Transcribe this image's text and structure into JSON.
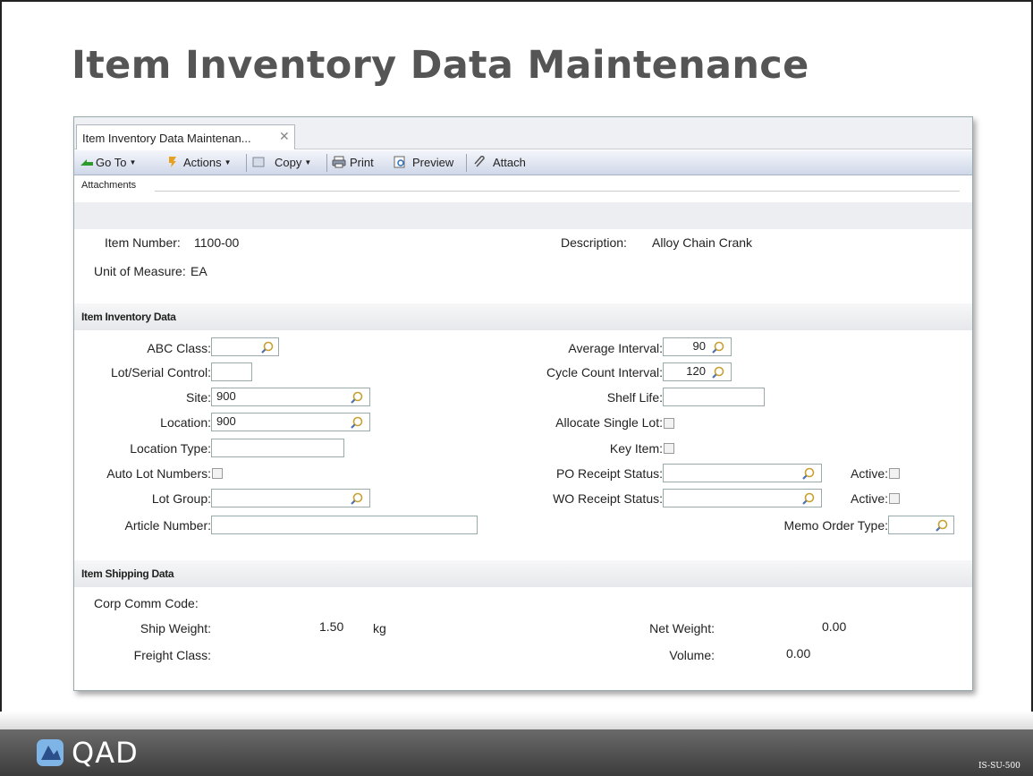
{
  "slide": {
    "title": "Item Inventory Data Maintenance",
    "code": "IS-SU-500"
  },
  "footer": {
    "logo_text": "QAD"
  },
  "window": {
    "tab_label": "Item Inventory Data Maintenan...",
    "toolbar": {
      "goto": "Go To",
      "actions": "Actions",
      "copy": "Copy",
      "print": "Print",
      "preview": "Preview",
      "attach": "Attach"
    },
    "attachments_label": "Attachments"
  },
  "header": {
    "item_number_label": "Item Number:",
    "item_number": "1100-00",
    "description_label": "Description:",
    "description": "Alloy Chain Crank",
    "uom_label": "Unit of Measure:",
    "uom": "EA"
  },
  "inventory": {
    "section_title": "Item Inventory Data",
    "abc_class_label": "ABC Class:",
    "abc_class": "",
    "lot_serial_label": "Lot/Serial Control:",
    "lot_serial": "",
    "site_label": "Site:",
    "site": "900",
    "location_label": "Location:",
    "location": "900",
    "location_type_label": "Location Type:",
    "location_type": "",
    "auto_lot_label": "Auto Lot Numbers:",
    "lot_group_label": "Lot Group:",
    "lot_group": "",
    "article_label": "Article Number:",
    "article": "",
    "avg_interval_label": "Average Interval:",
    "avg_interval": "90",
    "cycle_count_label": "Cycle Count Interval:",
    "cycle_count": "120",
    "shelf_life_label": "Shelf Life:",
    "shelf_life": "",
    "alloc_single_label": "Allocate Single Lot:",
    "key_item_label": "Key Item:",
    "po_receipt_label": "PO Receipt Status:",
    "po_receipt": "",
    "wo_receipt_label": "WO Receipt Status:",
    "wo_receipt": "",
    "active_label": "Active:",
    "memo_order_label": "Memo Order Type:",
    "memo_order": ""
  },
  "shipping": {
    "section_title": "Item Shipping Data",
    "corp_comm_label": "Corp Comm Code:",
    "ship_weight_label": "Ship Weight:",
    "ship_weight": "1.50",
    "ship_weight_unit": "kg",
    "freight_class_label": "Freight Class:",
    "net_weight_label": "Net Weight:",
    "net_weight": "0.00",
    "volume_label": "Volume:",
    "volume": "0.00"
  }
}
